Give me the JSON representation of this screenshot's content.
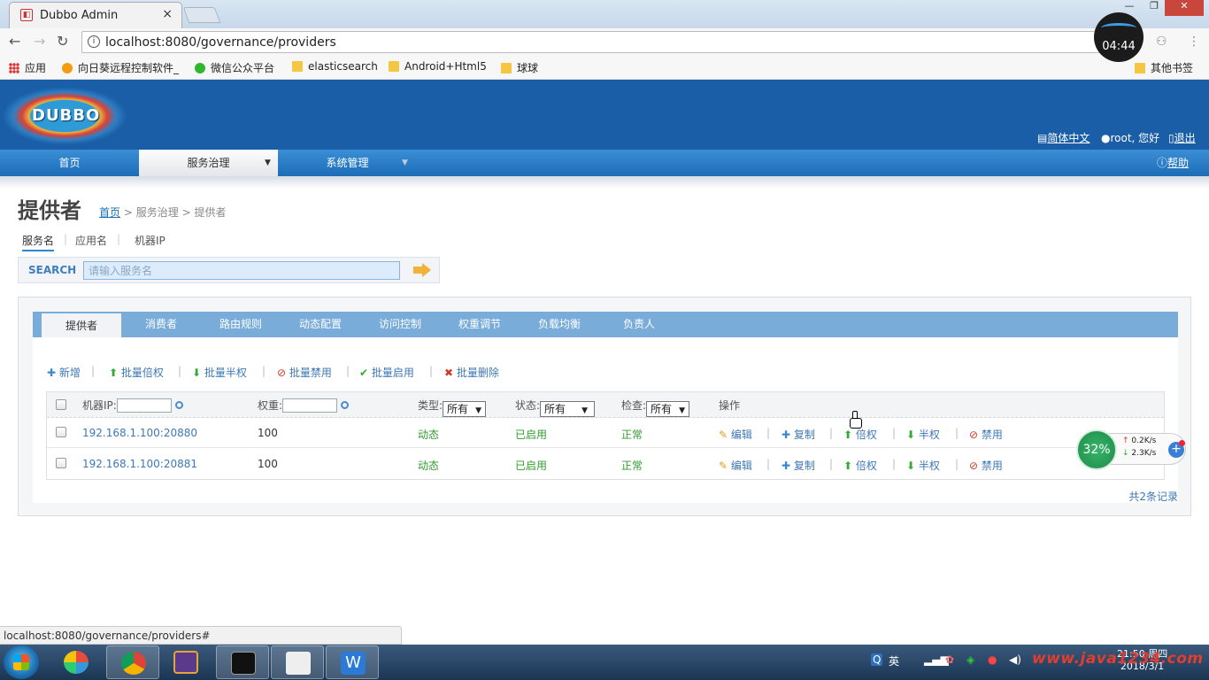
{
  "browser": {
    "tab_title": "Dubbo Admin",
    "tab_close": "×",
    "url": "localhost:8080/governance/providers",
    "timer": "04:44",
    "bookmarks": [
      {
        "label": "应用",
        "icon": "apps-grid-icon"
      },
      {
        "label": "向日葵远程控制软件_",
        "icon": "sunflower-icon"
      },
      {
        "label": "微信公众平台",
        "icon": "wechat-icon"
      },
      {
        "label": "elasticsearch",
        "icon": "folder-icon"
      },
      {
        "label": "Android+Html5",
        "icon": "folder-icon"
      },
      {
        "label": "球球",
        "icon": "folder-icon"
      },
      {
        "label": "其他书签",
        "icon": "folder-icon"
      }
    ],
    "status_url": "localhost:8080/governance/providers#"
  },
  "header": {
    "logo_text": "DUBBO",
    "lang": "简体中文",
    "user": "root, 您好",
    "logout": "退出",
    "help": "帮助"
  },
  "nav": {
    "items": [
      {
        "label": "首页"
      },
      {
        "label": "服务治理"
      },
      {
        "label": "系统管理"
      }
    ]
  },
  "page": {
    "title": "提供者",
    "breadcrumb": {
      "home": "首页",
      "mid": "服务治理",
      "current": "提供者"
    },
    "search_tabs": [
      "服务名",
      "应用名",
      "机器IP"
    ],
    "search_label": "SEARCH",
    "search_placeholder": "请输入服务名"
  },
  "panel": {
    "tabs": [
      "提供者",
      "消费者",
      "路由规则",
      "动态配置",
      "访问控制",
      "权重调节",
      "负载均衡",
      "负责人"
    ],
    "toolbar": [
      "新增",
      "批量倍权",
      "批量半权",
      "批量禁用",
      "批量启用",
      "批量删除"
    ],
    "filters": {
      "ip_label": "机器IP:",
      "weight_label": "权重:",
      "type_label": "类型:",
      "type_value": "所有",
      "status_label": "状态:",
      "status_value": "所有",
      "check_label": "检查:",
      "check_value": "所有",
      "ops_label": "操作"
    },
    "rows": [
      {
        "address": "192.168.1.100:20880",
        "weight": "100",
        "type": "动态",
        "status": "已启用",
        "check": "正常"
      },
      {
        "address": "192.168.1.100:20881",
        "weight": "100",
        "type": "动态",
        "status": "已启用",
        "check": "正常"
      }
    ],
    "row_actions": [
      "编辑",
      "复制",
      "倍权",
      "半权",
      "禁用"
    ],
    "total": "共2条记录"
  },
  "net_widget": {
    "percent": "32%",
    "up": "0.2K/s",
    "down": "2.3K/s"
  },
  "taskbar": {
    "ime": "英",
    "time": "21:50 周四",
    "date": "2018/3/1",
    "watermark": "www.java1234.com"
  }
}
